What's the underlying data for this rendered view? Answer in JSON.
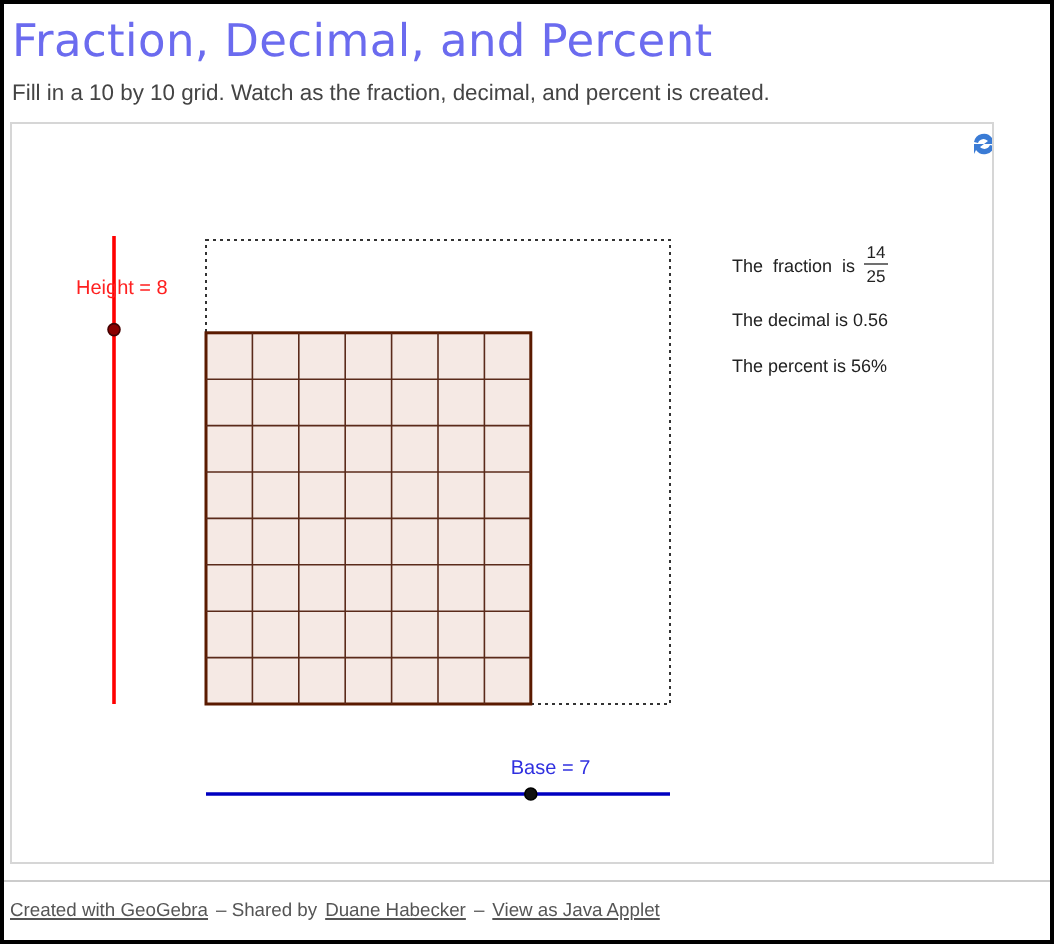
{
  "title": "Fraction, Decimal, and Percent",
  "instructions": "Fill in a 10 by 10 grid. Watch as the fraction, decimal, and percent is created.",
  "applet": {
    "height_slider": {
      "label": "Height = 8",
      "level": 0.8
    },
    "base_slider": {
      "label": "Base = 7",
      "level": 0.7
    },
    "fraction": {
      "text": "The  fraction  is",
      "numerator": "14",
      "denominator": "25"
    },
    "decimal_text": "The decimal is 0.56",
    "percent_text": "The percent is 56%"
  },
  "footer": [
    {
      "kind": "link",
      "text": "Created with GeoGebra"
    },
    {
      "kind": "text",
      "text": "– Shared by"
    },
    {
      "kind": "link",
      "text": "Duane Habecker"
    },
    {
      "kind": "text",
      "text": "–"
    },
    {
      "kind": "link",
      "text": "View as Java Applet"
    }
  ]
}
